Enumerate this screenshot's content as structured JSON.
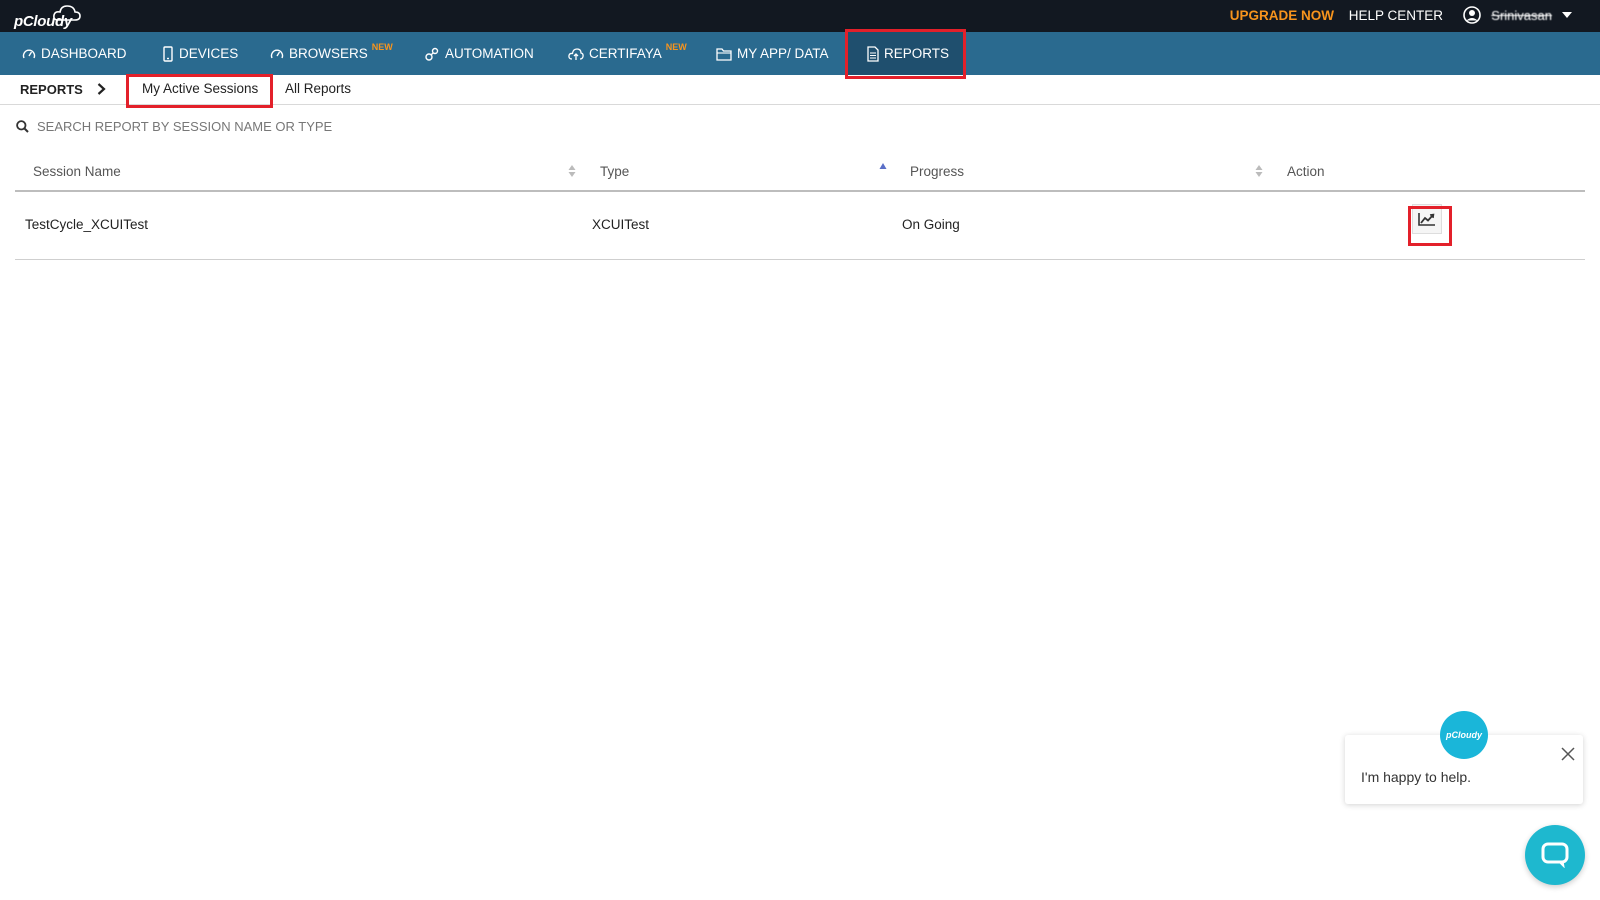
{
  "topbar": {
    "logo_text": "pCloudy",
    "upgrade_label": "UPGRADE NOW",
    "help_label": "HELP CENTER",
    "user_name": "Srinivasan"
  },
  "nav": {
    "items": [
      {
        "label": "DASHBOARD",
        "icon": "gauge-icon"
      },
      {
        "label": "DEVICES",
        "icon": "mobile-icon"
      },
      {
        "label": "BROWSERS",
        "icon": "gauge-icon",
        "badge": "NEW"
      },
      {
        "label": "AUTOMATION",
        "icon": "gears-icon"
      },
      {
        "label": "CERTIFAYA",
        "icon": "cloud-upload-icon",
        "badge": "NEW"
      },
      {
        "label": "MY APP/ DATA",
        "icon": "folder-icon"
      },
      {
        "label": "REPORTS",
        "icon": "document-icon"
      }
    ],
    "active": "REPORTS"
  },
  "subnav": {
    "title": "REPORTS",
    "tabs": [
      "My Active Sessions",
      "All Reports"
    ],
    "active": "My Active Sessions"
  },
  "search": {
    "placeholder": "SEARCH REPORT BY SESSION NAME OR TYPE"
  },
  "table": {
    "columns": [
      "Session Name",
      "Type",
      "Progress",
      "Action"
    ],
    "rows": [
      {
        "session_name": "TestCycle_XCUITest",
        "type": "XCUITest",
        "progress": "On Going",
        "action_icon": "line-chart-icon"
      }
    ]
  },
  "chat": {
    "message": "I'm happy to help.",
    "avatar_text": "pCloudy"
  },
  "colors": {
    "topbar_bg": "#121821",
    "nav_bg": "#2a6a8f",
    "nav_active_bg": "#1f4f6e",
    "accent_orange": "#f7941d",
    "highlight_red": "#e3202a",
    "chat_teal": "#1eb8cf"
  }
}
